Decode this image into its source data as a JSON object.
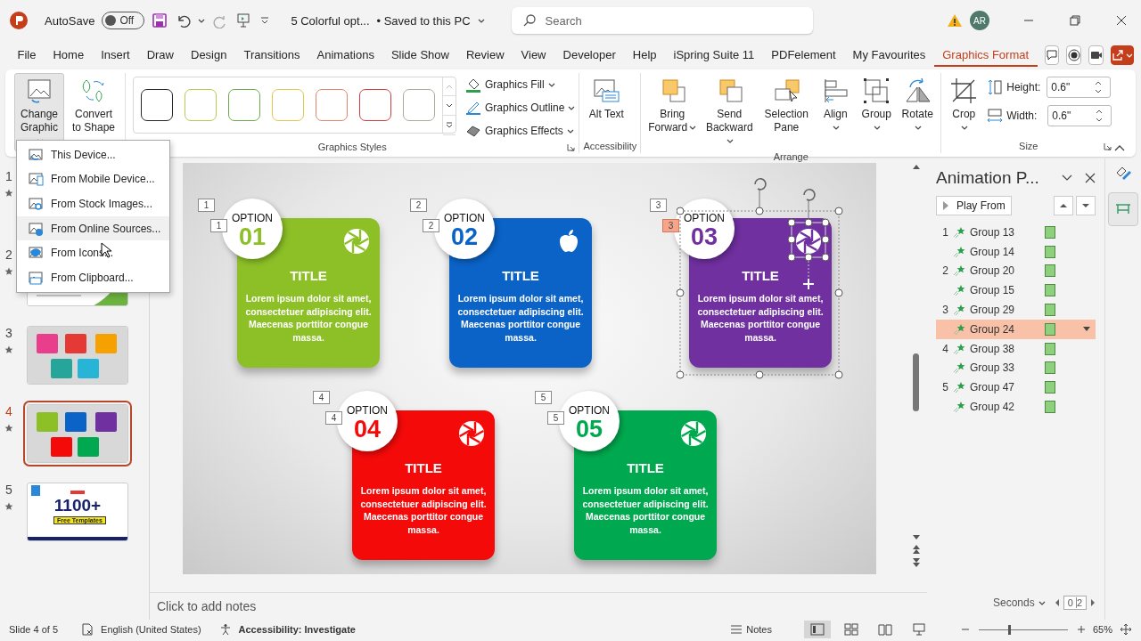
{
  "title_bar": {
    "autosave_label": "AutoSave",
    "autosave": {
      "on": false,
      "text": "Off"
    },
    "document": "5 Colorful opt...",
    "save_status": "• Saved to this PC",
    "search": {
      "placeholder": "Search"
    },
    "avatar": "AR"
  },
  "menu_tabs": [
    {
      "label": "File",
      "selected": false
    },
    {
      "label": "Home",
      "selected": false
    },
    {
      "label": "Insert",
      "selected": false
    },
    {
      "label": "Draw",
      "selected": false
    },
    {
      "label": "Design",
      "selected": false
    },
    {
      "label": "Transitions",
      "selected": false
    },
    {
      "label": "Animations",
      "selected": false
    },
    {
      "label": "Slide Show",
      "selected": false
    },
    {
      "label": "Review",
      "selected": false
    },
    {
      "label": "View",
      "selected": false
    },
    {
      "label": "Developer",
      "selected": false
    },
    {
      "label": "Help",
      "selected": false
    },
    {
      "label": "iSpring Suite 11",
      "selected": false
    },
    {
      "label": "PDFelement",
      "selected": false
    },
    {
      "label": "My Favourites",
      "selected": false
    },
    {
      "label": "Graphics Format",
      "selected": true
    }
  ],
  "ribbon": {
    "change_graphic": {
      "label": "Change Graphic",
      "pressed": true
    },
    "convert": "Convert to Shape",
    "styles": [
      {
        "color": "#262626"
      },
      {
        "color": "#b9c94e"
      },
      {
        "color": "#6cab4c"
      },
      {
        "color": "#e2c84a"
      },
      {
        "color": "#e0866a"
      },
      {
        "color": "#c9403c"
      },
      {
        "color": "#a9ad98"
      }
    ],
    "styles_label": "Graphics Styles",
    "graphic_commands": [
      {
        "kind": "fill",
        "label": "Graphics Fill"
      },
      {
        "kind": "outline",
        "label": "Graphics Outline"
      },
      {
        "kind": "effects",
        "label": "Graphics Effects"
      }
    ],
    "alt_text": "Alt Text",
    "accessibility_label": "Accessibility",
    "arrange": [
      {
        "kind": "bring",
        "label": "Bring Forward",
        "dropdown": true
      },
      {
        "kind": "send",
        "label": "Send Backward",
        "dropdown": true
      },
      {
        "kind": "selection",
        "label": "Selection Pane",
        "dropdown": false
      },
      {
        "kind": "align",
        "label": "Align",
        "dropdown": true
      },
      {
        "kind": "group",
        "label": "Group",
        "dropdown": true
      },
      {
        "kind": "rotate",
        "label": "Rotate",
        "dropdown": true
      }
    ],
    "arrange_label": "Arrange",
    "crop": "Crop",
    "height": {
      "label": "Height:",
      "value": "0.6\""
    },
    "width": {
      "label": "Width:",
      "value": "0.6\""
    },
    "size_label": "Size"
  },
  "graphic_menu": [
    {
      "kind": "device",
      "label": "This Device...",
      "hovered": false
    },
    {
      "kind": "mobile",
      "label": "From Mobile Device...",
      "hovered": false
    },
    {
      "kind": "stock",
      "label": "From Stock Images...",
      "hovered": false
    },
    {
      "kind": "online",
      "label": "From Online Sources...",
      "hovered": true
    },
    {
      "kind": "icons",
      "label": "From Icons...",
      "hovered": false
    },
    {
      "kind": "clipboard",
      "label": "From Clipboard...",
      "hovered": false
    }
  ],
  "slides": [
    {
      "number": "1",
      "selected": false
    },
    {
      "number": "2",
      "selected": false,
      "kind": "list"
    },
    {
      "number": "3",
      "selected": false,
      "kind": "cards_warm"
    },
    {
      "number": "4",
      "selected": true,
      "kind": "cards_bright"
    },
    {
      "number": "5",
      "selected": false,
      "kind": "promo",
      "headline": "1100+",
      "tagline": "Free Templates"
    }
  ],
  "slide": {
    "cards": [
      {
        "option": "OPTION",
        "number": "01",
        "title": "TITLE",
        "body": "Lorem ipsum dolor sit amet, consectetuer adipiscing elit. Maecenas porttitor congue massa.",
        "color": "#8cc026",
        "kind": "aperture",
        "selected": false,
        "tags": [
          {
            "text": "1",
            "selected": false
          },
          {
            "text": "1",
            "selected": false
          }
        ]
      },
      {
        "option": "OPTION",
        "number": "02",
        "title": "TITLE",
        "body": "Lorem ipsum dolor sit amet, consectetuer adipiscing elit. Maecenas porttitor congue massa.",
        "color": "#0b63c7",
        "kind": "apple",
        "selected": false,
        "tags": [
          {
            "text": "2",
            "selected": false
          },
          {
            "text": "2",
            "selected": false
          }
        ]
      },
      {
        "option": "OPTION",
        "number": "03",
        "title": "TITLE",
        "body": "Lorem ipsum dolor sit amet, consectetuer adipiscing elit. Maecenas porttitor congue massa.",
        "color": "#7030a0",
        "kind": "aperture",
        "selected": true,
        "tags": [
          {
            "text": "3",
            "selected": false
          },
          {
            "text": "3",
            "selected": true
          }
        ]
      },
      {
        "option": "OPTION",
        "number": "04",
        "title": "TITLE",
        "body": "Lorem ipsum dolor sit amet, consectetuer adipiscing elit. Maecenas porttitor congue massa.",
        "color": "#f50a0a",
        "kind": "aperture",
        "selected": false,
        "tags": [
          {
            "text": "4",
            "selected": false
          },
          {
            "text": "4",
            "selected": false
          }
        ]
      },
      {
        "option": "OPTION",
        "number": "05",
        "title": "TITLE",
        "body": "Lorem ipsum dolor sit amet, consectetuer adipiscing elit. Maecenas porttitor congue massa.",
        "color": "#00a94f",
        "kind": "aperture",
        "selected": false,
        "tags": [
          {
            "text": "5",
            "selected": false
          },
          {
            "text": "5",
            "selected": false
          }
        ]
      }
    ]
  },
  "notes": {
    "placeholder": "Click to add notes"
  },
  "animation_pane": {
    "title": "Animation P...",
    "play": "Play From",
    "items": [
      {
        "number": "1",
        "name": "Group 13",
        "selected": false
      },
      {
        "name": "Group 14",
        "selected": false
      },
      {
        "number": "2",
        "name": "Group 20",
        "selected": false
      },
      {
        "name": "Group 15",
        "selected": false
      },
      {
        "number": "3",
        "name": "Group 29",
        "selected": false
      },
      {
        "name": "Group 24",
        "selected": true
      },
      {
        "number": "4",
        "name": "Group 38",
        "selected": false
      },
      {
        "name": "Group 33",
        "selected": false
      },
      {
        "number": "5",
        "name": "Group 47",
        "selected": false
      },
      {
        "name": "Group 42",
        "selected": false
      }
    ],
    "units": "Seconds",
    "timeline": [
      "0",
      "2"
    ]
  },
  "status_bar": {
    "slide": "Slide 4 of 5",
    "language": "English (United States)",
    "accessibility": "Accessibility: Investigate",
    "notes": "Notes",
    "views": [
      {
        "kind": "normal",
        "selected": true
      },
      {
        "kind": "sorter",
        "selected": false
      },
      {
        "kind": "reading",
        "selected": false
      },
      {
        "kind": "show",
        "selected": false
      }
    ],
    "zoom": {
      "level": 0.33,
      "text": "65%"
    }
  }
}
